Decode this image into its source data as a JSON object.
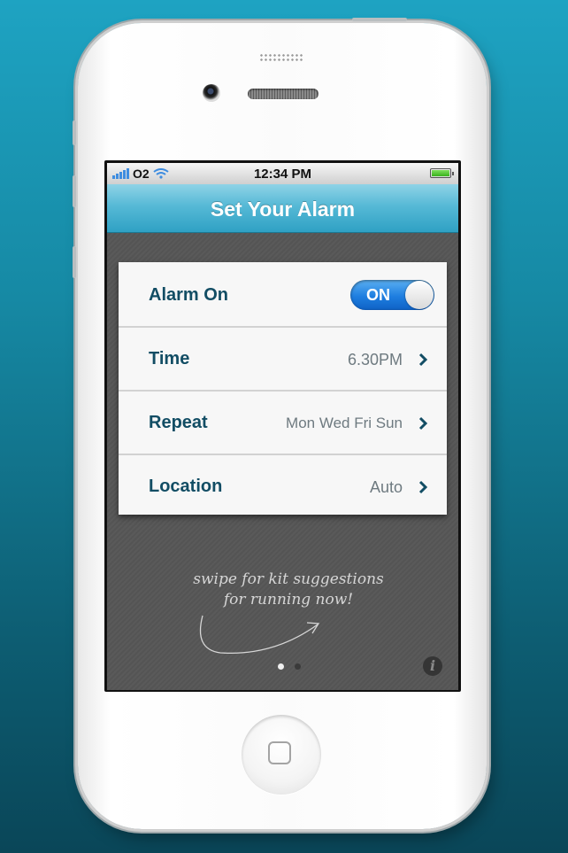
{
  "status_bar": {
    "carrier": "O2",
    "time": "12:34 PM"
  },
  "nav": {
    "title": "Set Your Alarm"
  },
  "settings": [
    {
      "label": "Alarm On",
      "toggle": "ON"
    },
    {
      "label": "Time",
      "value": "6.30PM"
    },
    {
      "label": "Repeat",
      "value": "Mon Wed Fri Sun"
    },
    {
      "label": "Location",
      "value": "Auto"
    }
  ],
  "hint": {
    "line1": "swipe for kit suggestions",
    "line2": "for running now!"
  },
  "page_indicator": {
    "count": 2,
    "active": 1
  },
  "icons": [
    "signal-icon",
    "wifi-icon",
    "battery-icon",
    "chevron-right-icon",
    "info-icon",
    "home-button"
  ],
  "colors": {
    "nav_accent": "#2fa1c4",
    "toggle_on": "#1e7ee0",
    "label_text": "#124d64"
  }
}
